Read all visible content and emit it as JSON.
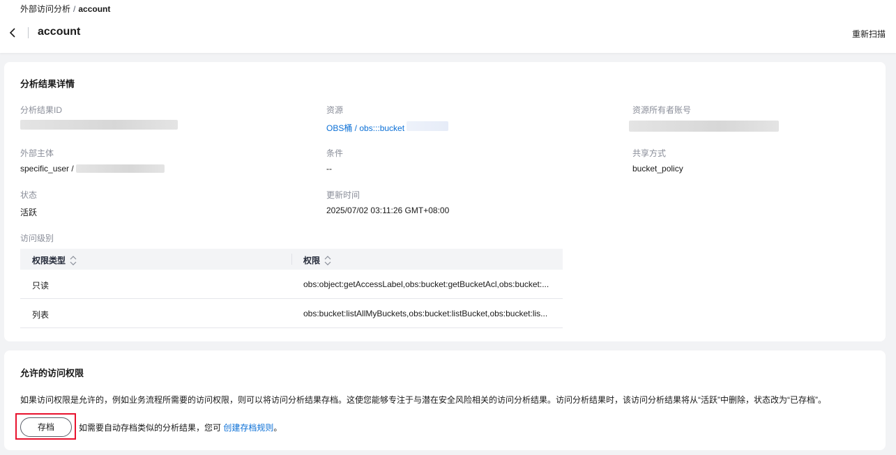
{
  "breadcrumb": {
    "parent": "外部访问分析",
    "separator": "/",
    "current": "account"
  },
  "header": {
    "title": "account",
    "rescan_label": "重新扫描"
  },
  "details": {
    "title": "分析结果详情",
    "result_id_label": "分析结果ID",
    "resource_label": "资源",
    "resource_value": "OBS桶 / obs:::bucket",
    "owner_label": "资源所有者账号",
    "principal_label": "外部主体",
    "principal_value": "specific_user /",
    "condition_label": "条件",
    "condition_value": "--",
    "share_label": "共享方式",
    "share_value": "bucket_policy",
    "status_label": "状态",
    "status_value": "活跃",
    "updated_label": "更新时间",
    "updated_value": "2025/07/02 03:11:26 GMT+08:00",
    "access_level_label": "访问级别"
  },
  "table": {
    "columns": [
      "权限类型",
      "权限"
    ],
    "rows": [
      {
        "type": "只读",
        "permission": "obs:object:getAccessLabel,obs:bucket:getBucketAcl,obs:bucket:..."
      },
      {
        "type": "列表",
        "permission": "obs:bucket:listAllMyBuckets,obs:bucket:listBucket,obs:bucket:lis..."
      }
    ]
  },
  "allowed": {
    "title": "允许的访问权限",
    "description": "如果访问权限是允许的，例如业务流程所需要的访问权限，则可以将访问分析结果存档。这使您能够专注于与潜在安全风险相关的访问分析结果。访问分析结果时，该访问分析结果将从“活跃”中删除，状态改为“已存档”。",
    "archive_label": "存档",
    "hint_prefix": "如需要自动存档类似的分析结果，您可",
    "hint_link": "创建存档规则",
    "hint_suffix": "。"
  },
  "colors": {
    "link": "#0a6fd6",
    "highlight": "#e8112d"
  },
  "icons": {
    "back": "chevron-left-icon",
    "sort": "sort-icon"
  }
}
